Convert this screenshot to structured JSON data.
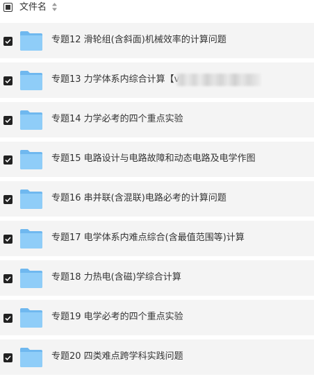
{
  "header": {
    "column_label": "文件名"
  },
  "files": [
    {
      "name": "专题12 滑轮组(含斜面)机械效率的计算问题",
      "checked": true
    },
    {
      "name": "专题13 力学体系内综合计算【v",
      "checked": true,
      "redacted_suffix": true
    },
    {
      "name": "专题14 力学必考的四个重点实验",
      "checked": true
    },
    {
      "name": "专题15 电路设计与电路故障和动态电路及电学作图",
      "checked": true
    },
    {
      "name": "专题16 串并联(含混联)电路必考的计算问题",
      "checked": true
    },
    {
      "name": "专题17 电学体系内难点综合(含最值范围等)计算",
      "checked": true
    },
    {
      "name": "专题18 力热电(含磁)学综合计算",
      "checked": true
    },
    {
      "name": "专题19 电学必考的四个重点实验",
      "checked": true
    },
    {
      "name": "专题20 四类难点跨学科实践问题",
      "checked": true
    }
  ],
  "icons": {
    "folder": "folder-icon",
    "checkbox": "checkbox-checked-icon",
    "sort": "sort-icon"
  },
  "colors": {
    "folder": "#7fc4f5",
    "row_background": "#f4f4f4",
    "checkbox": "#222222"
  }
}
